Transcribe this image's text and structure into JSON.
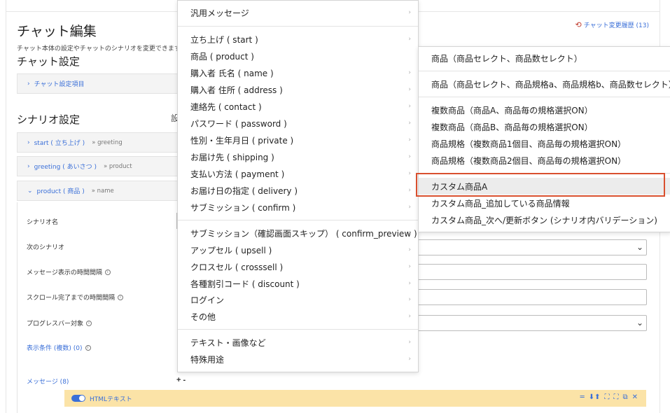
{
  "page": {
    "title": "チャット編集",
    "description": "チャット本体の設定やチャットのシナリオを変更できます",
    "history_link": "チャット変更履歴 (13)",
    "chat_settings_title": "チャット設定",
    "chat_settings_item": "チャット設定項目",
    "scenario_title": "シナリオ設定",
    "scenario_stub": "設",
    "accordions": [
      {
        "label": "start ( 立ち上げ )",
        "next": "» greeting",
        "open": false
      },
      {
        "label": "greeting ( あいさつ )",
        "next": "» product",
        "open": false
      },
      {
        "label": "product ( 商品 )",
        "next": "» name",
        "open": true
      }
    ],
    "fields": {
      "scenario_name": "シナリオ名",
      "next_scenario": "次のシナリオ",
      "message_interval": "メッセージ表示の時間間隔",
      "scroll_interval": "スクロール完了までの時間間隔",
      "progress_target": "プログレスバー対象",
      "display_condition": "表示条件 (複数) (0)",
      "messages": "メッセージ (8)"
    },
    "plus_dash": "+ -",
    "html_bar_label": "HTMLテキスト",
    "bar_tools": [
      "═",
      "⬇⬆",
      "⛶",
      "⛶",
      "⧉",
      "✕"
    ],
    "icons": {
      "history": "history-icon",
      "info": "info-icon",
      "chevron_right": "chevron-right-icon",
      "chevron_down": "chevron-down-icon",
      "toggle": "toggle-icon"
    }
  },
  "menu": {
    "groups": [
      {
        "items": [
          "汎用メッセージ"
        ]
      },
      {
        "items": [
          "立ち上げ ( start )",
          "商品 ( product )",
          "購入者 氏名 ( name )",
          "購入者 住所 ( address )",
          "連絡先 ( contact )",
          "パスワード ( password )",
          "性別・生年月日 ( private )",
          "お届け先 ( shipping )",
          "支払い方法 ( payment )",
          "お届け日の指定 ( delivery )",
          "サブミッション ( confirm )"
        ]
      },
      {
        "items": [
          "サブミッション（確認画面スキップ） ( confirm_preview )",
          "アップセル ( upsell )",
          "クロスセル ( crosssell )",
          "各種割引コード ( discount )",
          "ログイン",
          "その他"
        ]
      },
      {
        "items": [
          "テキスト・画像など",
          "特殊用途"
        ]
      }
    ],
    "caret": "›"
  },
  "submenu": {
    "groups": [
      {
        "items": [
          "商品（商品セレクト、商品数セレクト）"
        ]
      },
      {
        "items": [
          "商品（商品セレクト、商品規格a、商品規格b、商品数セレクト）"
        ]
      },
      {
        "items": [
          "複数商品（商品A、商品毎の規格選択ON）",
          "複数商品（商品B、商品毎の規格選択ON）",
          "商品規格（複数商品1個目、商品毎の規格選択ON）",
          "商品規格（複数商品2個目、商品毎の規格選択ON）"
        ]
      },
      {
        "items": [
          "カスタム商品A",
          "カスタム商品_追加している商品情報",
          "カスタム商品_次へ/更新ボタン (シナリオ内バリデーション)"
        ]
      }
    ],
    "hovered": "カスタム商品A"
  },
  "colors": {
    "link": "#3a6fd8",
    "highlight": "#d9502f",
    "html_bar": "#fbe3a7",
    "history_icon": "#c0392b"
  }
}
